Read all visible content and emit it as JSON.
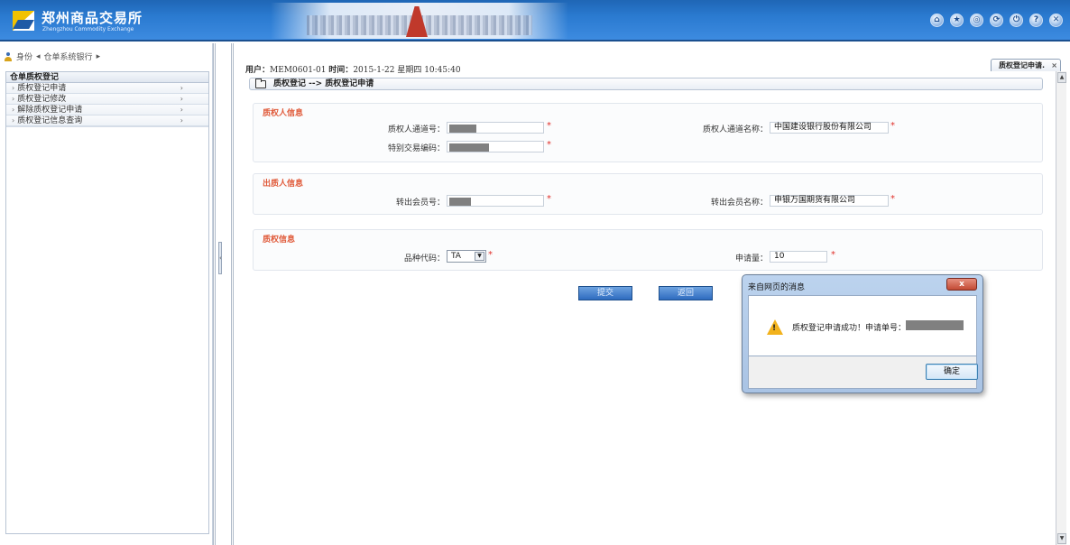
{
  "header": {
    "logo_text": "郑州商品交易所",
    "logo_sub": "Zhengzhou Commodity Exchange",
    "icons": [
      "home-icon",
      "favorite-icon",
      "settings-icon",
      "refresh-icon",
      "logout-icon",
      "help-icon",
      "close-icon"
    ],
    "icon_glyphs": [
      "⌂",
      "★",
      "◎",
      "⟳",
      "⏻",
      "?",
      "✕"
    ]
  },
  "sidebar": {
    "breadcrumb": [
      "身份",
      "◂",
      "仓单系统银行",
      "▸"
    ],
    "menu_title": "仓单质权登记",
    "items": [
      {
        "label": "质权登记申请"
      },
      {
        "label": "质权登记修改"
      },
      {
        "label": "解除质权登记申请"
      },
      {
        "label": "质权登记信息查询"
      }
    ],
    "bullet": "›",
    "arrow": "›"
  },
  "main": {
    "user_label": "用户：",
    "user_value": "MEM0601-01",
    "time_label": "时间：",
    "time_value": "2015-1-22 星期四 10:45:40",
    "tab_label": "质权登记申请.",
    "tab_close": "×",
    "page_title": "质权登记 --> 质权登记申请",
    "sections": {
      "pledgee": {
        "title": "质权人信息",
        "channel_no_label": "质权人通道号：",
        "channel_name_label": "质权人通道名称：",
        "channel_name_value": "中国建设银行股份有限公司",
        "special_code_label": "特别交易编码："
      },
      "pledgor": {
        "title": "出质人信息",
        "out_member_no_label": "转出会员号：",
        "out_member_name_label": "转出会员名称：",
        "out_member_name_value": "申银万国期货有限公司"
      },
      "pledge": {
        "title": "质权信息",
        "variety_label": "品种代码：",
        "variety_value": "TA",
        "quantity_label": "申请量：",
        "quantity_value": "10"
      }
    },
    "required_mark": "*",
    "submit_label": "提交",
    "back_label": "返回"
  },
  "dialog": {
    "title": "来自网页的消息",
    "close_label": "x",
    "message": "质权登记申请成功！申请单号：",
    "ok_label": "确定",
    "warn_mark": "!"
  }
}
